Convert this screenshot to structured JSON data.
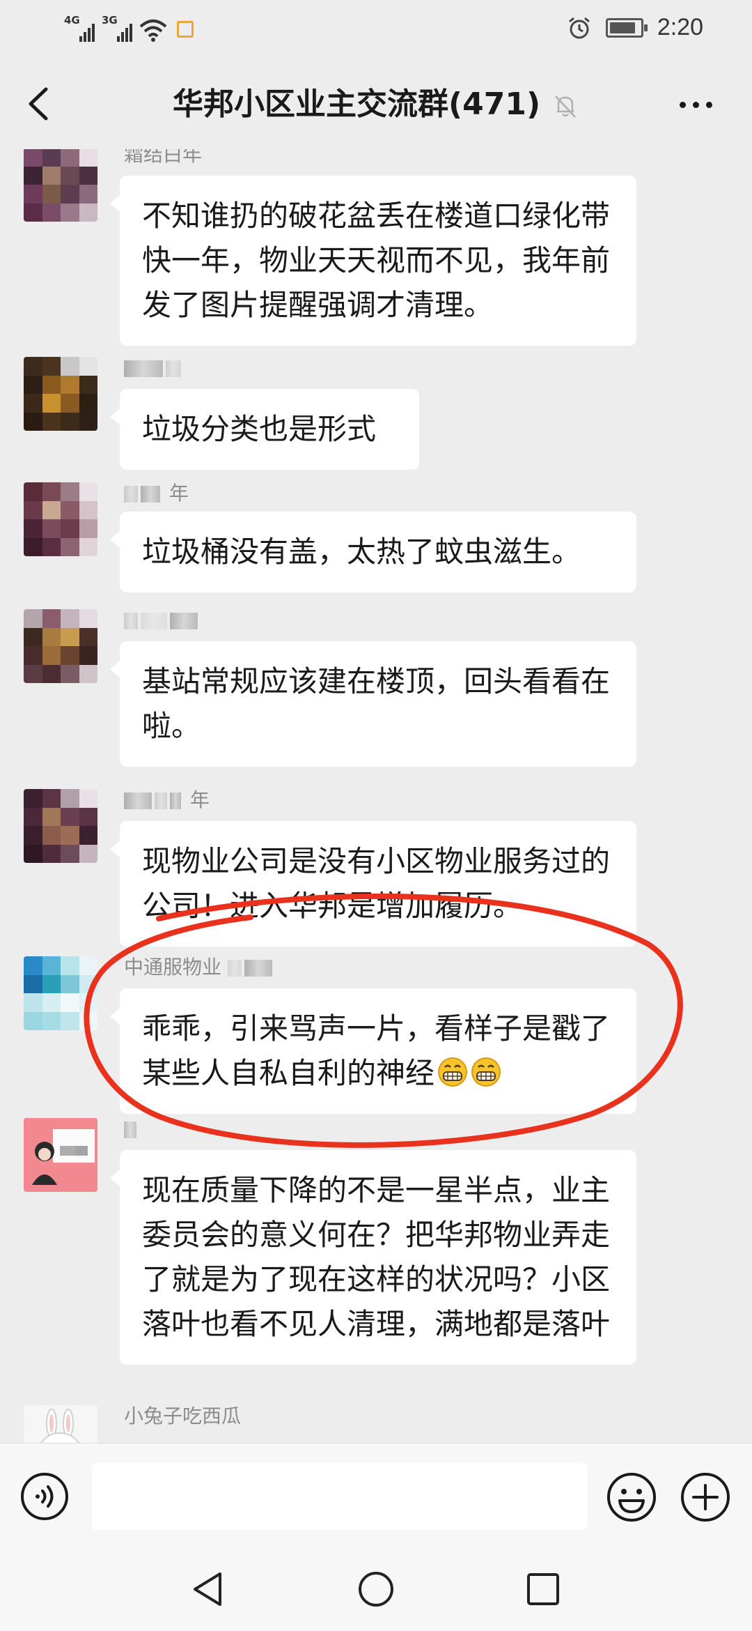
{
  "status_bar": {
    "signal1_label": "4G",
    "signal2_label": "3G",
    "time": "2:20",
    "icons": [
      "signal-icon",
      "wifi-icon",
      "sim-badge-icon",
      "alarm-icon",
      "battery-icon"
    ]
  },
  "header": {
    "title": "华邦小区业主交流群(471)",
    "icons": [
      "back-arrow-icon",
      "mute-bell-icon",
      "more-dots-icon"
    ]
  },
  "messages": [
    {
      "sender": "霜结白年",
      "text": "不知谁扔的破花盆丢在楼道口绿化带快一年，物业天天视而不见，我年前发了图片提醒强调才清理。"
    },
    {
      "sender": "",
      "text": "垃圾分类也是形式"
    },
    {
      "sender": "年",
      "text": "垃圾桶没有盖，太热了蚊虫滋生。"
    },
    {
      "sender": "",
      "text": "基站常规应该建在楼顶，回头看看在啦。"
    },
    {
      "sender": "年",
      "text": "现物业公司是没有小区物业服务过的公司！进入华邦是增加履历。"
    },
    {
      "sender": "中通服物业",
      "text": "乖乖，引来骂声一片，看样子是戳了某些人自私自利的神经",
      "emoji": [
        "grinning-face",
        "grinning-face"
      ]
    },
    {
      "sender": "",
      "text": "现在质量下降的不是一星半点，业主委员会的意义何在？把华邦物业弄走了就是为了现在这样的状况吗？小区落叶也看不见人清理，满地都是落叶"
    },
    {
      "sender": "小兔子吃西瓜",
      "text": ""
    }
  ],
  "annotation": {
    "shape": "hand-drawn ellipse",
    "color": "#e8321e"
  },
  "input_bar": {
    "placeholder": "",
    "icons": [
      "voice-icon",
      "emoji-icon",
      "plus-icon"
    ]
  },
  "system_nav": {
    "icons": [
      "nav-back-icon",
      "nav-home-icon",
      "nav-recents-icon"
    ]
  },
  "colors": {
    "background": "#ededed",
    "bubble": "#ffffff",
    "sender_name": "#8c8c8c",
    "annotation_red": "#e8321e"
  }
}
